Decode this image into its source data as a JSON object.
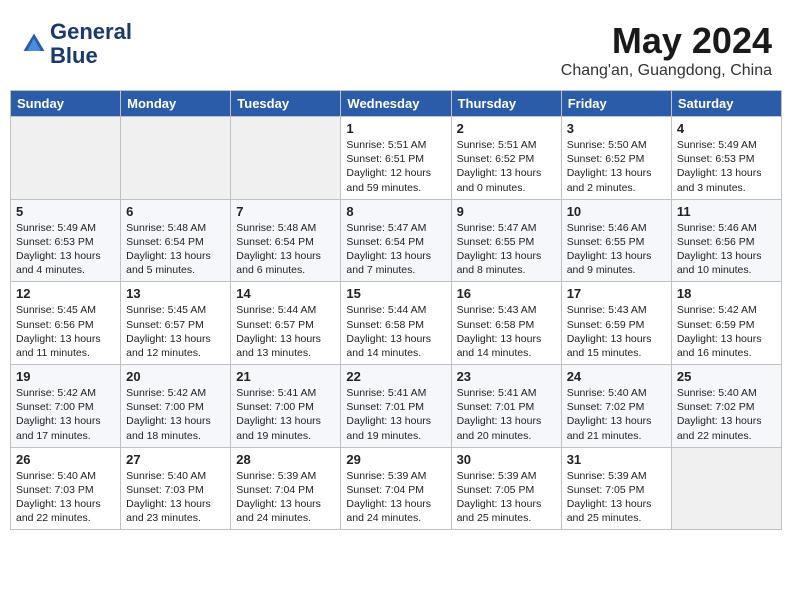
{
  "header": {
    "logo_line1": "General",
    "logo_line2": "Blue",
    "month": "May 2024",
    "location": "Chang'an, Guangdong, China"
  },
  "weekdays": [
    "Sunday",
    "Monday",
    "Tuesday",
    "Wednesday",
    "Thursday",
    "Friday",
    "Saturday"
  ],
  "weeks": [
    [
      {
        "day": "",
        "content": ""
      },
      {
        "day": "",
        "content": ""
      },
      {
        "day": "",
        "content": ""
      },
      {
        "day": "1",
        "content": "Sunrise: 5:51 AM\nSunset: 6:51 PM\nDaylight: 12 hours\nand 59 minutes."
      },
      {
        "day": "2",
        "content": "Sunrise: 5:51 AM\nSunset: 6:52 PM\nDaylight: 13 hours\nand 0 minutes."
      },
      {
        "day": "3",
        "content": "Sunrise: 5:50 AM\nSunset: 6:52 PM\nDaylight: 13 hours\nand 2 minutes."
      },
      {
        "day": "4",
        "content": "Sunrise: 5:49 AM\nSunset: 6:53 PM\nDaylight: 13 hours\nand 3 minutes."
      }
    ],
    [
      {
        "day": "5",
        "content": "Sunrise: 5:49 AM\nSunset: 6:53 PM\nDaylight: 13 hours\nand 4 minutes."
      },
      {
        "day": "6",
        "content": "Sunrise: 5:48 AM\nSunset: 6:54 PM\nDaylight: 13 hours\nand 5 minutes."
      },
      {
        "day": "7",
        "content": "Sunrise: 5:48 AM\nSunset: 6:54 PM\nDaylight: 13 hours\nand 6 minutes."
      },
      {
        "day": "8",
        "content": "Sunrise: 5:47 AM\nSunset: 6:54 PM\nDaylight: 13 hours\nand 7 minutes."
      },
      {
        "day": "9",
        "content": "Sunrise: 5:47 AM\nSunset: 6:55 PM\nDaylight: 13 hours\nand 8 minutes."
      },
      {
        "day": "10",
        "content": "Sunrise: 5:46 AM\nSunset: 6:55 PM\nDaylight: 13 hours\nand 9 minutes."
      },
      {
        "day": "11",
        "content": "Sunrise: 5:46 AM\nSunset: 6:56 PM\nDaylight: 13 hours\nand 10 minutes."
      }
    ],
    [
      {
        "day": "12",
        "content": "Sunrise: 5:45 AM\nSunset: 6:56 PM\nDaylight: 13 hours\nand 11 minutes."
      },
      {
        "day": "13",
        "content": "Sunrise: 5:45 AM\nSunset: 6:57 PM\nDaylight: 13 hours\nand 12 minutes."
      },
      {
        "day": "14",
        "content": "Sunrise: 5:44 AM\nSunset: 6:57 PM\nDaylight: 13 hours\nand 13 minutes."
      },
      {
        "day": "15",
        "content": "Sunrise: 5:44 AM\nSunset: 6:58 PM\nDaylight: 13 hours\nand 14 minutes."
      },
      {
        "day": "16",
        "content": "Sunrise: 5:43 AM\nSunset: 6:58 PM\nDaylight: 13 hours\nand 14 minutes."
      },
      {
        "day": "17",
        "content": "Sunrise: 5:43 AM\nSunset: 6:59 PM\nDaylight: 13 hours\nand 15 minutes."
      },
      {
        "day": "18",
        "content": "Sunrise: 5:42 AM\nSunset: 6:59 PM\nDaylight: 13 hours\nand 16 minutes."
      }
    ],
    [
      {
        "day": "19",
        "content": "Sunrise: 5:42 AM\nSunset: 7:00 PM\nDaylight: 13 hours\nand 17 minutes."
      },
      {
        "day": "20",
        "content": "Sunrise: 5:42 AM\nSunset: 7:00 PM\nDaylight: 13 hours\nand 18 minutes."
      },
      {
        "day": "21",
        "content": "Sunrise: 5:41 AM\nSunset: 7:00 PM\nDaylight: 13 hours\nand 19 minutes."
      },
      {
        "day": "22",
        "content": "Sunrise: 5:41 AM\nSunset: 7:01 PM\nDaylight: 13 hours\nand 19 minutes."
      },
      {
        "day": "23",
        "content": "Sunrise: 5:41 AM\nSunset: 7:01 PM\nDaylight: 13 hours\nand 20 minutes."
      },
      {
        "day": "24",
        "content": "Sunrise: 5:40 AM\nSunset: 7:02 PM\nDaylight: 13 hours\nand 21 minutes."
      },
      {
        "day": "25",
        "content": "Sunrise: 5:40 AM\nSunset: 7:02 PM\nDaylight: 13 hours\nand 22 minutes."
      }
    ],
    [
      {
        "day": "26",
        "content": "Sunrise: 5:40 AM\nSunset: 7:03 PM\nDaylight: 13 hours\nand 22 minutes."
      },
      {
        "day": "27",
        "content": "Sunrise: 5:40 AM\nSunset: 7:03 PM\nDaylight: 13 hours\nand 23 minutes."
      },
      {
        "day": "28",
        "content": "Sunrise: 5:39 AM\nSunset: 7:04 PM\nDaylight: 13 hours\nand 24 minutes."
      },
      {
        "day": "29",
        "content": "Sunrise: 5:39 AM\nSunset: 7:04 PM\nDaylight: 13 hours\nand 24 minutes."
      },
      {
        "day": "30",
        "content": "Sunrise: 5:39 AM\nSunset: 7:05 PM\nDaylight: 13 hours\nand 25 minutes."
      },
      {
        "day": "31",
        "content": "Sunrise: 5:39 AM\nSunset: 7:05 PM\nDaylight: 13 hours\nand 25 minutes."
      },
      {
        "day": "",
        "content": ""
      }
    ]
  ]
}
